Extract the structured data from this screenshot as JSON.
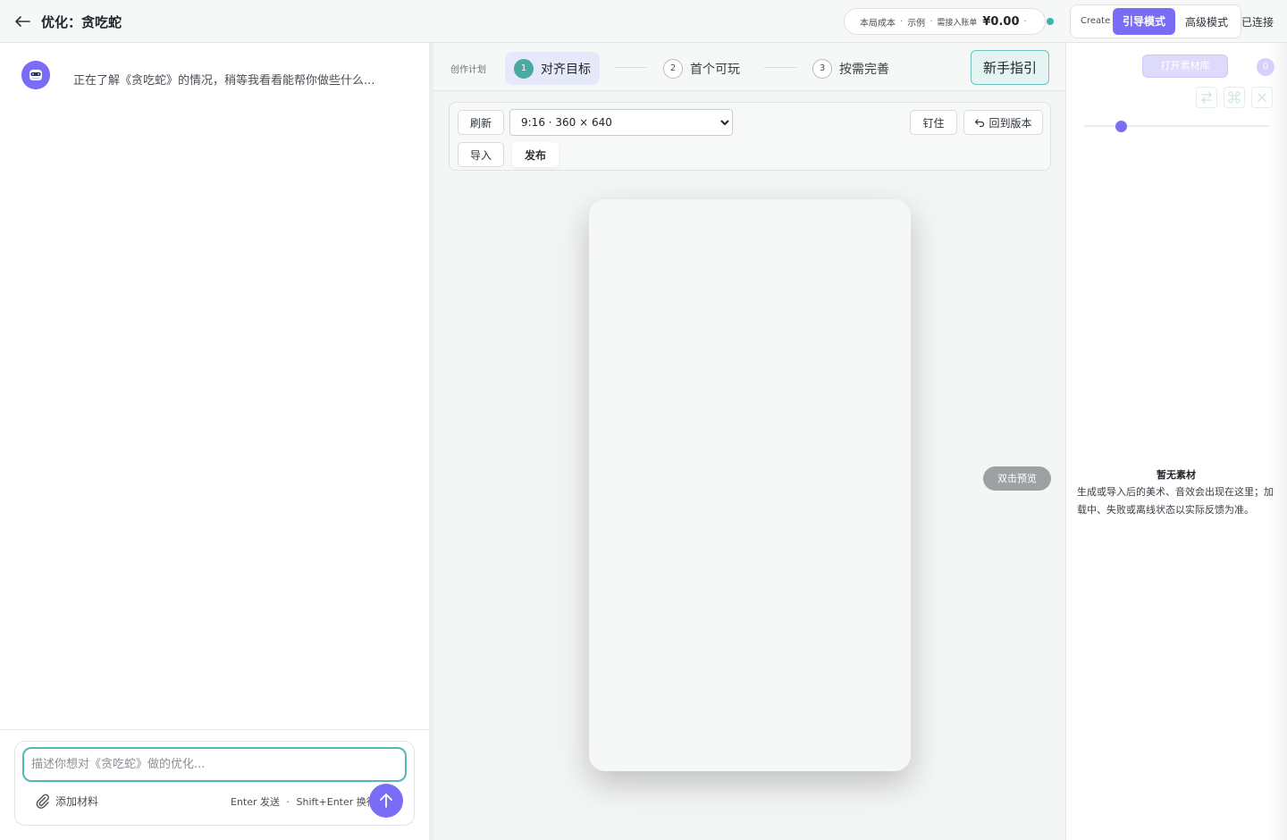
{
  "header": {
    "title": "优化：贪吃蛇",
    "cost": {
      "label": "本局成本",
      "separator": "·",
      "example": "示例",
      "note": "需接入账单",
      "amount": "¥0.00"
    },
    "modes": {
      "create": "Create",
      "guided": "引导模式",
      "advanced": "高级模式"
    },
    "connection_status": "已连接"
  },
  "chat": {
    "message": "正在了解《贪吃蛇》的情况，稍等我看看能帮你做些什么...",
    "input_placeholder": "描述你想对《贪吃蛇》做的优化...",
    "attach_label": "添加材料",
    "hint_send": "Enter 发送",
    "hint_separator": "·",
    "hint_newline": "Shift+Enter 换行"
  },
  "plan": {
    "label": "创作计划",
    "steps": [
      {
        "num": "1",
        "label": "对齐目标"
      },
      {
        "num": "2",
        "label": "首个可玩"
      },
      {
        "num": "3",
        "label": "按需完善"
      }
    ],
    "guide_button": "新手指引"
  },
  "toolbar": {
    "refresh": "刷新",
    "size_selected": "9:16 · 360 × 640",
    "pin": "钉住",
    "revert": "回到版本",
    "import": "导入",
    "publish": "发布"
  },
  "preview": {
    "badge": "双击预览"
  },
  "assets": {
    "open_button": "打开素材库",
    "count": "0",
    "slider_value": 0.2,
    "empty_title": "暂无素材",
    "empty_desc": "生成或导入后的美术、音效会出现在这里；加载中、失败或离线状态以实际反馈为准。"
  },
  "colors": {
    "accent": "#7b6cf6",
    "teal": "#4aa9a3",
    "status_online": "#3fb4ad"
  },
  "icons": [
    "back-arrow-icon",
    "robot-icon",
    "paperclip-icon",
    "arrow-up-icon",
    "undo-icon",
    "swap-icon",
    "command-icon",
    "close-icon"
  ]
}
